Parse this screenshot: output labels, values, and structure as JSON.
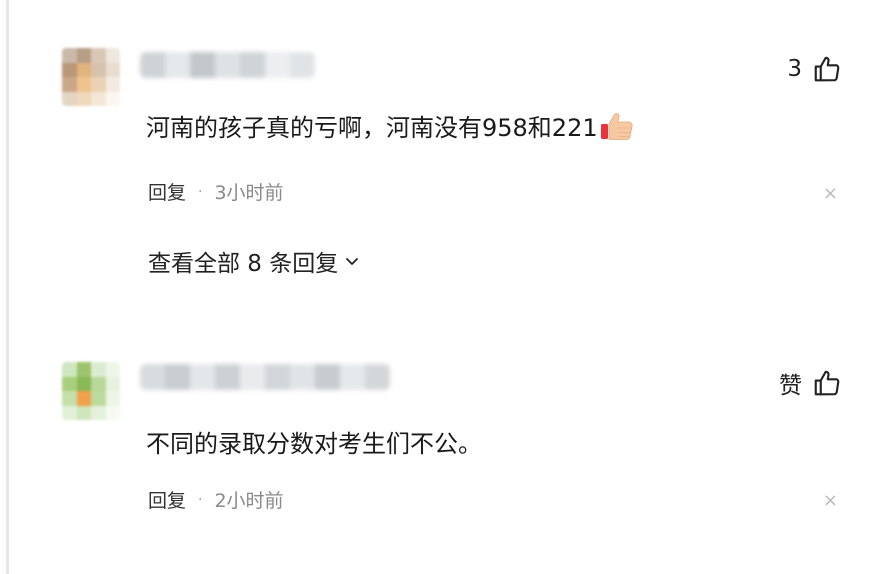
{
  "comments": [
    {
      "like_count": "3",
      "text": "河南的孩子真的亏啊，河南没有958和221",
      "reply_label": "回复",
      "separator": "·",
      "time": "3小时前",
      "close_glyph": "×",
      "view_all_label": "查看全部 8 条回复"
    },
    {
      "like_count": "赞",
      "text": "不同的录取分数对考生们不公。",
      "reply_label": "回复",
      "separator": "·",
      "time": "2小时前",
      "close_glyph": "×"
    }
  ],
  "icons": {
    "like": "thumbs-up-icon",
    "emoji": "thumbs-up-emoji",
    "chevron": "chevron-down-icon"
  }
}
